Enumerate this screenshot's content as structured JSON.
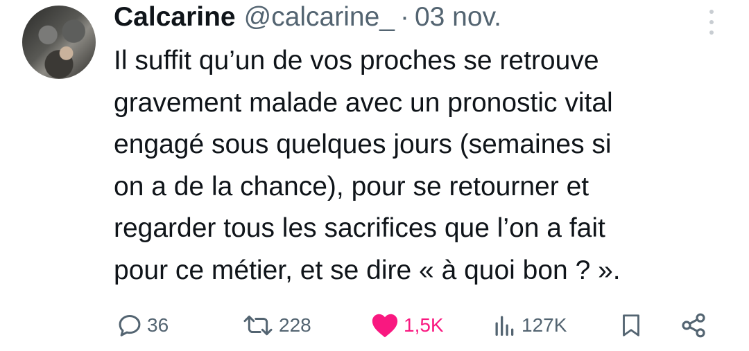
{
  "tweet": {
    "author_name": "Calcarine",
    "handle": "@calcarine_",
    "separator": "·",
    "date": "03 nov.",
    "text_lines": [
      "Il suffit qu’un de vos proches se retrouve",
      "gravement malade avec un pronostic vital",
      "engagé sous quelques jours (semaines si",
      "on a de la chance), pour se retourner et",
      "regarder tous les sacrifices que l’on a fait",
      "pour ce métier, et se dire « à quoi bon ? »."
    ]
  },
  "actions": {
    "replies": "36",
    "retweets": "228",
    "likes": "1,5K",
    "views": "127K"
  },
  "icons": {
    "reply": "speech-bubble-icon",
    "retweet": "retweet-arrows-icon",
    "like": "heart-filled-icon",
    "views": "bar-chart-icon",
    "bookmark": "bookmark-icon",
    "share": "share-nodes-icon",
    "more": "vertical-dots-icon"
  },
  "colors": {
    "like_active": "#f91880",
    "secondary_text": "#536471",
    "primary_text": "#0f1419"
  }
}
